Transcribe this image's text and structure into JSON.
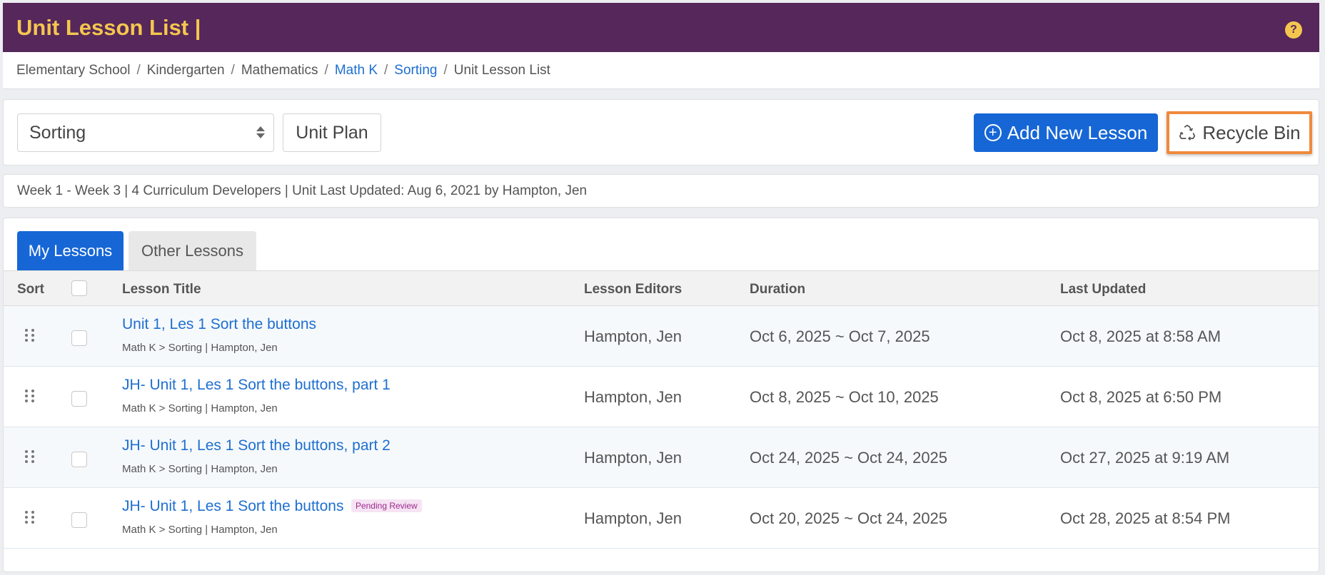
{
  "header": {
    "title": "Unit Lesson List |",
    "help_symbol": "?"
  },
  "breadcrumb": {
    "items": [
      "Elementary School",
      "Kindergarten",
      "Mathematics",
      "Math K",
      "Sorting",
      "Unit Lesson List"
    ],
    "separator": "/"
  },
  "toolbar": {
    "unit_select_value": "Sorting",
    "unit_plan_label": "Unit Plan",
    "add_lesson_label": "Add New Lesson",
    "add_icon_symbol": "+",
    "recycle_bin_label": "Recycle Bin",
    "highlight_color": "#ef8a3c"
  },
  "info_bar": {
    "text": "Week 1 - Week 3 | 4 Curriculum Developers | Unit Last Updated: Aug 6, 2021 by Hampton, Jen"
  },
  "tabs": [
    {
      "label": "My Lessons",
      "active": true
    },
    {
      "label": "Other Lessons",
      "active": false
    }
  ],
  "table": {
    "columns": {
      "sort": "Sort",
      "title": "Lesson Title",
      "editors": "Lesson Editors",
      "duration": "Duration",
      "updated": "Last Updated"
    },
    "rows": [
      {
        "title": "Unit 1, Les 1 Sort the buttons",
        "badge": "",
        "sub": "Math K > Sorting  |  Hampton, Jen",
        "editor": "Hampton, Jen",
        "duration": "Oct 6, 2025 ~ Oct 7, 2025",
        "updated": "Oct 8, 2025 at 8:58 AM"
      },
      {
        "title": "JH- Unit 1, Les 1 Sort the buttons, part 1",
        "badge": "",
        "sub": "Math K > Sorting  |  Hampton, Jen",
        "editor": "Hampton, Jen",
        "duration": "Oct 8, 2025 ~ Oct 10, 2025",
        "updated": "Oct 8, 2025 at 6:50 PM"
      },
      {
        "title": "JH- Unit 1, Les 1 Sort the buttons, part 2",
        "badge": "",
        "sub": "Math K > Sorting  |  Hampton, Jen",
        "editor": "Hampton, Jen",
        "duration": "Oct 24, 2025 ~ Oct 24, 2025",
        "updated": "Oct 27, 2025 at 9:19 AM"
      },
      {
        "title": "JH- Unit 1, Les 1 Sort the buttons",
        "badge": "Pending Review",
        "sub": "Math K > Sorting  |  Hampton, Jen",
        "editor": "Hampton, Jen",
        "duration": "Oct 20, 2025 ~ Oct 24, 2025",
        "updated": "Oct 28, 2025 at 8:54 PM"
      }
    ]
  },
  "colors": {
    "header_bg": "#55275a",
    "header_text": "#f4c64f",
    "primary": "#1666d6",
    "link": "#1e6fd0"
  }
}
